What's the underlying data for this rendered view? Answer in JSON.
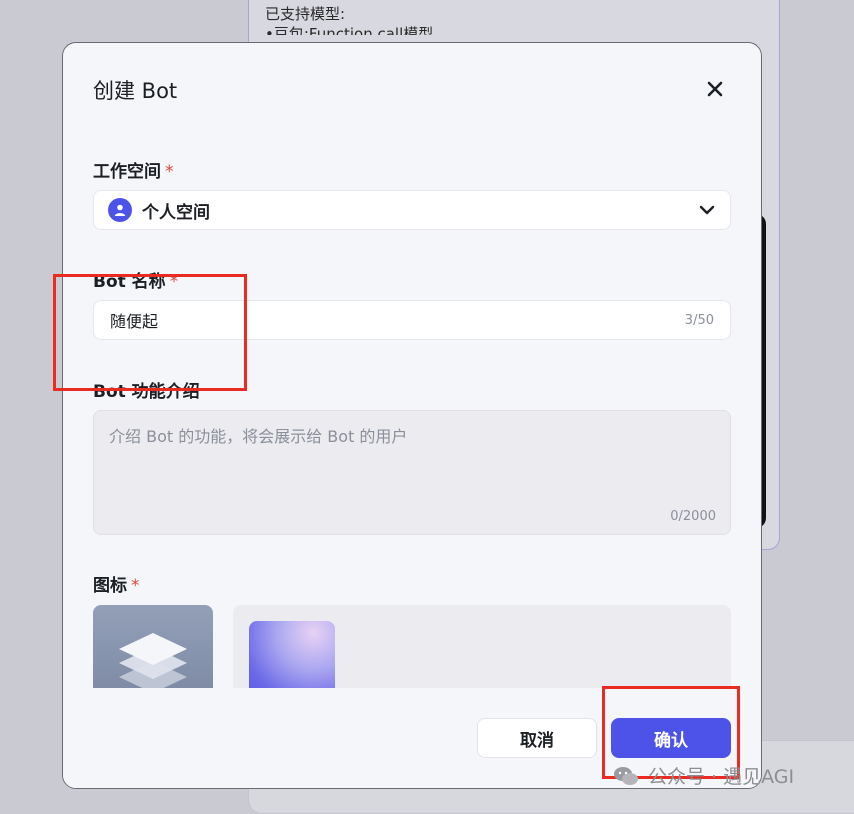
{
  "background": {
    "text_line1": "已支持模型:",
    "text_line2": "•豆包:Function call模型"
  },
  "modal": {
    "title": "创建 Bot",
    "workspace": {
      "label": "工作空间",
      "required_mark": "*",
      "selected": "个人空间"
    },
    "bot_name": {
      "label": "Bot 名称",
      "required_mark": "*",
      "value": "随便起",
      "counter": "3/50"
    },
    "bot_description": {
      "label": "Bot 功能介绍",
      "placeholder": "介绍 Bot 的功能，将会展示给 Bot 的用户",
      "counter": "0/2000"
    },
    "icon": {
      "label": "图标",
      "required_mark": "*"
    },
    "buttons": {
      "cancel": "取消",
      "confirm": "确认"
    }
  },
  "watermark": "公众号 · 遇见AGI",
  "colors": {
    "primary": "#4d53e8",
    "required": "#e0443e",
    "annotation": "#ea2b22"
  },
  "icons": {
    "close": "close-icon",
    "dropdown": "chevron-down-icon",
    "workspace": "user-icon"
  }
}
